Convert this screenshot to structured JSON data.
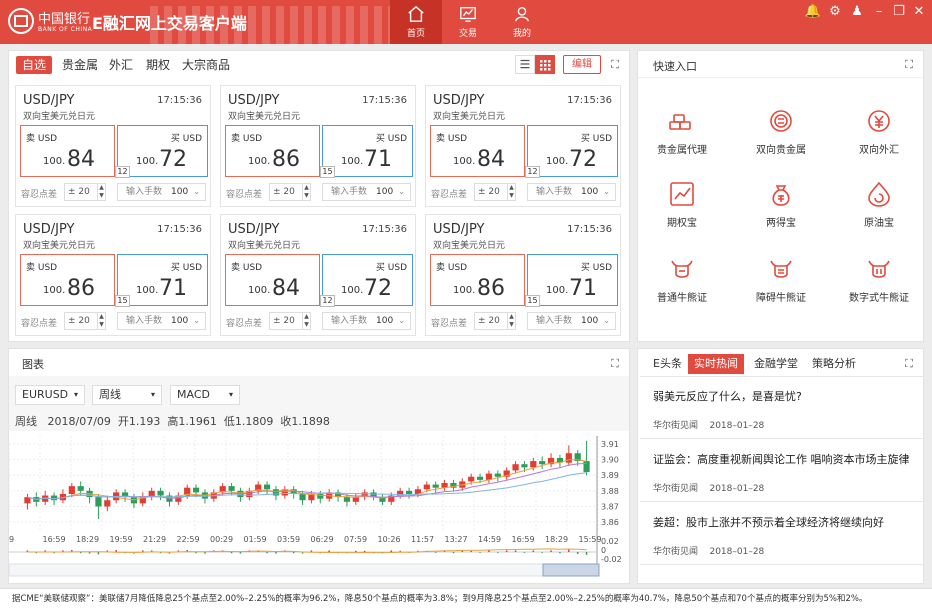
{
  "header": {
    "bank_name": "中国银行",
    "bank_sub": "BANK OF CHINA",
    "app_title": "E融汇网上交易客户端",
    "tabs": [
      {
        "label": "首页",
        "icon": "home-icon"
      },
      {
        "label": "交易",
        "icon": "chart-icon"
      },
      {
        "label": "我的",
        "icon": "user-icon"
      }
    ],
    "window_controls": {
      "bell": "🔔",
      "gear": "⚙",
      "user": "♟",
      "min": "–",
      "restore": "❐",
      "close": "✕"
    }
  },
  "filter_tabs": [
    "自选",
    "贵金属",
    "外汇",
    "期权",
    "大宗商品"
  ],
  "edit_label": "编辑",
  "quotes": [
    {
      "pair": "USD/JPY",
      "time": "17:15:36",
      "desc": "双向宝美元兑日元",
      "sell_label": "卖 USD",
      "sell_pre": "100.",
      "sell_big": "84",
      "buy_label": "买 USD",
      "buy_pre": "100.",
      "buy_big": "72",
      "spread": "12",
      "tol_label": "容忍点差",
      "tol_value": "± 20",
      "lot_label": "输入手数",
      "lot_value": "100"
    },
    {
      "pair": "USD/JPY",
      "time": "17:15:36",
      "desc": "双向宝美元兑日元",
      "sell_label": "卖 USD",
      "sell_pre": "100.",
      "sell_big": "86",
      "buy_label": "买 USD",
      "buy_pre": "100.",
      "buy_big": "71",
      "spread": "15",
      "tol_label": "容忍点差",
      "tol_value": "± 20",
      "lot_label": "输入手数",
      "lot_value": "100"
    },
    {
      "pair": "USD/JPY",
      "time": "17:15:36",
      "desc": "双向宝美元兑日元",
      "sell_label": "卖 USD",
      "sell_pre": "100.",
      "sell_big": "84",
      "buy_label": "买 USD",
      "buy_pre": "100.",
      "buy_big": "72",
      "spread": "12",
      "tol_label": "容忍点差",
      "tol_value": "± 20",
      "lot_label": "输入手数",
      "lot_value": "100"
    },
    {
      "pair": "USD/JPY",
      "time": "17:15:36",
      "desc": "双向宝美元兑日元",
      "sell_label": "卖 USD",
      "sell_pre": "100.",
      "sell_big": "86",
      "buy_label": "买 USD",
      "buy_pre": "100.",
      "buy_big": "71",
      "spread": "15",
      "tol_label": "容忍点差",
      "tol_value": "± 20",
      "lot_label": "输入手数",
      "lot_value": "100"
    },
    {
      "pair": "USD/JPY",
      "time": "17:15:36",
      "desc": "双向宝美元兑日元",
      "sell_label": "卖 USD",
      "sell_pre": "100.",
      "sell_big": "84",
      "buy_label": "买 USD",
      "buy_pre": "100.",
      "buy_big": "72",
      "spread": "12",
      "tol_label": "容忍点差",
      "tol_value": "± 20",
      "lot_label": "输入手数",
      "lot_value": "100"
    },
    {
      "pair": "USD/JPY",
      "time": "17:15:36",
      "desc": "双向宝美元兑日元",
      "sell_label": "卖 USD",
      "sell_pre": "100.",
      "sell_big": "86",
      "buy_label": "买 USD",
      "buy_pre": "100.",
      "buy_big": "71",
      "spread": "15",
      "tol_label": "容忍点差",
      "tol_value": "± 20",
      "lot_label": "输入手数",
      "lot_value": "100"
    }
  ],
  "quick_entry": {
    "title": "快速入口",
    "items": [
      {
        "label": "贵金属代理",
        "icon": "gold-bars-icon"
      },
      {
        "label": "双向贵金属",
        "icon": "gold-coin-icon"
      },
      {
        "label": "双向外汇",
        "icon": "currency-exchange-icon"
      },
      {
        "label": "期权宝",
        "icon": "trend-chart-icon"
      },
      {
        "label": "两得宝",
        "icon": "money-bag-icon"
      },
      {
        "label": "原油宝",
        "icon": "oil-refresh-icon"
      },
      {
        "label": "普通牛熊证",
        "icon": "bull-icon"
      },
      {
        "label": "障碍牛熊证",
        "icon": "bull-barrier-icon"
      },
      {
        "label": "数字式牛熊证",
        "icon": "bull-digital-icon"
      }
    ]
  },
  "chart_panel": {
    "title": "图表",
    "selects": [
      "EURUSD",
      "周线",
      "MACD"
    ],
    "info": {
      "period": "周线",
      "date": "2018/07/09",
      "open": "开1.193",
      "high": "高1.1961",
      "low": "低1.1809",
      "close": "收1.1898"
    }
  },
  "chart_data": {
    "type": "candlestick",
    "x_ticks": [
      "9",
      "16:59",
      "18:29",
      "19:59",
      "21:29",
      "22:59",
      "00:29",
      "01:59",
      "03:59",
      "06:29",
      "07:59",
      "10:26",
      "11:57",
      "13:27",
      "14:59",
      "16:59",
      "18:29",
      "15:59"
    ],
    "y_ticks": [
      "3.91",
      "3.90",
      "3.89",
      "3.88",
      "3.87",
      "3.86"
    ],
    "macd_ticks": [
      "0.02",
      "0",
      "-0.02"
    ],
    "ylim": [
      3.855,
      3.915
    ],
    "candles": [
      [
        3.872,
        3.876,
        3.868,
        3.878
      ],
      [
        3.876,
        3.873,
        3.87,
        3.879
      ],
      [
        3.873,
        3.877,
        3.871,
        3.88
      ],
      [
        3.877,
        3.874,
        3.871,
        3.879
      ],
      [
        3.874,
        3.878,
        3.872,
        3.881
      ],
      [
        3.878,
        3.883,
        3.876,
        3.885
      ],
      [
        3.883,
        3.88,
        3.877,
        3.886
      ],
      [
        3.88,
        3.876,
        3.872,
        3.882
      ],
      [
        3.876,
        3.87,
        3.862,
        3.878
      ],
      [
        3.87,
        3.874,
        3.867,
        3.877
      ],
      [
        3.874,
        3.879,
        3.872,
        3.881
      ],
      [
        3.879,
        3.876,
        3.873,
        3.881
      ],
      [
        3.876,
        3.872,
        3.869,
        3.878
      ],
      [
        3.872,
        3.876,
        3.87,
        3.879
      ],
      [
        3.876,
        3.88,
        3.874,
        3.882
      ],
      [
        3.88,
        3.877,
        3.874,
        3.882
      ],
      [
        3.877,
        3.873,
        3.87,
        3.879
      ],
      [
        3.873,
        3.877,
        3.871,
        3.879
      ],
      [
        3.877,
        3.882,
        3.875,
        3.884
      ],
      [
        3.882,
        3.879,
        3.876,
        3.884
      ],
      [
        3.879,
        3.875,
        3.872,
        3.881
      ],
      [
        3.875,
        3.879,
        3.873,
        3.881
      ],
      [
        3.879,
        3.883,
        3.877,
        3.885
      ],
      [
        3.883,
        3.88,
        3.877,
        3.885
      ],
      [
        3.88,
        3.876,
        3.873,
        3.882
      ],
      [
        3.876,
        3.88,
        3.874,
        3.882
      ],
      [
        3.88,
        3.884,
        3.878,
        3.886
      ],
      [
        3.884,
        3.881,
        3.878,
        3.886
      ],
      [
        3.881,
        3.877,
        3.874,
        3.883
      ],
      [
        3.877,
        3.881,
        3.875,
        3.883
      ],
      [
        3.881,
        3.878,
        3.875,
        3.883
      ],
      [
        3.878,
        3.874,
        3.871,
        3.88
      ],
      [
        3.874,
        3.878,
        3.872,
        3.88
      ],
      [
        3.878,
        3.875,
        3.872,
        3.88
      ],
      [
        3.875,
        3.879,
        3.873,
        3.881
      ],
      [
        3.879,
        3.876,
        3.873,
        3.881
      ],
      [
        3.876,
        3.873,
        3.87,
        3.878
      ],
      [
        3.873,
        3.876,
        3.871,
        3.878
      ],
      [
        3.876,
        3.879,
        3.874,
        3.881
      ],
      [
        3.879,
        3.876,
        3.874,
        3.881
      ],
      [
        3.876,
        3.873,
        3.871,
        3.878
      ],
      [
        3.873,
        3.877,
        3.871,
        3.879
      ],
      [
        3.877,
        3.88,
        3.875,
        3.882
      ],
      [
        3.88,
        3.878,
        3.875,
        3.882
      ],
      [
        3.878,
        3.881,
        3.876,
        3.883
      ],
      [
        3.881,
        3.884,
        3.879,
        3.886
      ],
      [
        3.884,
        3.882,
        3.879,
        3.886
      ],
      [
        3.882,
        3.885,
        3.88,
        3.887
      ],
      [
        3.885,
        3.882,
        3.88,
        3.887
      ],
      [
        3.882,
        3.886,
        3.88,
        3.888
      ],
      [
        3.886,
        3.889,
        3.884,
        3.891
      ],
      [
        3.889,
        3.887,
        3.885,
        3.891
      ],
      [
        3.887,
        3.891,
        3.885,
        3.893
      ],
      [
        3.891,
        3.889,
        3.886,
        3.893
      ],
      [
        3.889,
        3.893,
        3.887,
        3.895
      ],
      [
        3.893,
        3.897,
        3.891,
        3.899
      ],
      [
        3.897,
        3.895,
        3.892,
        3.899
      ],
      [
        3.895,
        3.899,
        3.893,
        3.901
      ],
      [
        3.899,
        3.897,
        3.894,
        3.902
      ],
      [
        3.897,
        3.901,
        3.895,
        3.904
      ],
      [
        3.901,
        3.898,
        3.895,
        3.903
      ],
      [
        3.898,
        3.904,
        3.896,
        3.909
      ],
      [
        3.904,
        3.899,
        3.896,
        3.906
      ],
      [
        3.899,
        3.892,
        3.89,
        3.912
      ]
    ]
  },
  "news": {
    "tabs": [
      "E头条",
      "实时热闻",
      "金融学堂",
      "策略分析"
    ],
    "active_tab": 1,
    "items": [
      {
        "title": "弱美元反应了什么，是喜是忧?",
        "source": "华尔街见闻",
        "date": "2018–01–28"
      },
      {
        "title": "证监会：高度重视新闻舆论工作 唱响资本市场主旋律",
        "source": "华尔街见闻",
        "date": "2018–01–28"
      },
      {
        "title": "姜超：股市上涨并不预示着全球经济将继续向好",
        "source": "华尔街见闻",
        "date": "2018–01–28"
      }
    ]
  },
  "ticker_text": "据CME“美联储观察”：美联储7月降低降息25个基点至2.00%–2.25%的概率为96.2%，降息50个基点的概率为3.8%；到9月降息25个基点至2.00%–2.25%的概率为40.7%，降息50个基点和70个基点的概率分别为5%和2%。",
  "colors": {
    "brand": "#e04a3f",
    "sell": "#e36b57",
    "buy": "#4b9ad8",
    "up": "#e33d32",
    "down": "#2e9d5a"
  }
}
